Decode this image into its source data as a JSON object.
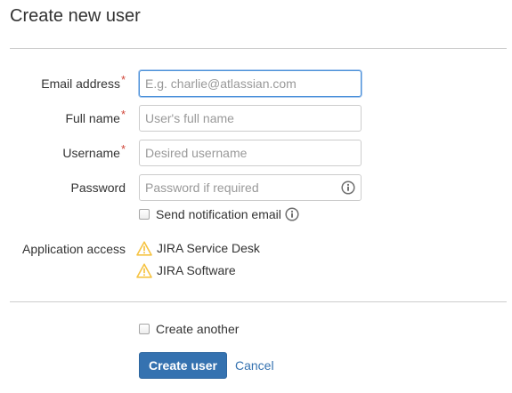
{
  "dialog": {
    "title": "Create new user"
  },
  "form": {
    "email": {
      "label": "Email address",
      "required_mark": "*",
      "placeholder": "E.g. charlie@atlassian.com",
      "value": ""
    },
    "full_name": {
      "label": "Full name",
      "required_mark": "*",
      "placeholder": "User's full name",
      "value": ""
    },
    "username": {
      "label": "Username",
      "required_mark": "*",
      "placeholder": "Desired username",
      "value": ""
    },
    "password": {
      "label": "Password",
      "placeholder": "Password if required",
      "value": "",
      "icon": "info-icon"
    },
    "send_notification": {
      "label": "Send notification email",
      "checked": false,
      "icon": "info-icon"
    },
    "application_access": {
      "label": "Application access",
      "apps": [
        {
          "name": "JIRA Service Desk",
          "icon": "warning-icon"
        },
        {
          "name": "JIRA Software",
          "icon": "warning-icon"
        }
      ]
    }
  },
  "footer": {
    "create_another": {
      "label": "Create another",
      "checked": false
    },
    "create_button_label": "Create user",
    "cancel_label": "Cancel"
  },
  "colors": {
    "primary": "#3572b0",
    "required": "#d04437",
    "warning": "#f6c342",
    "focus_border": "#4a90d9"
  }
}
